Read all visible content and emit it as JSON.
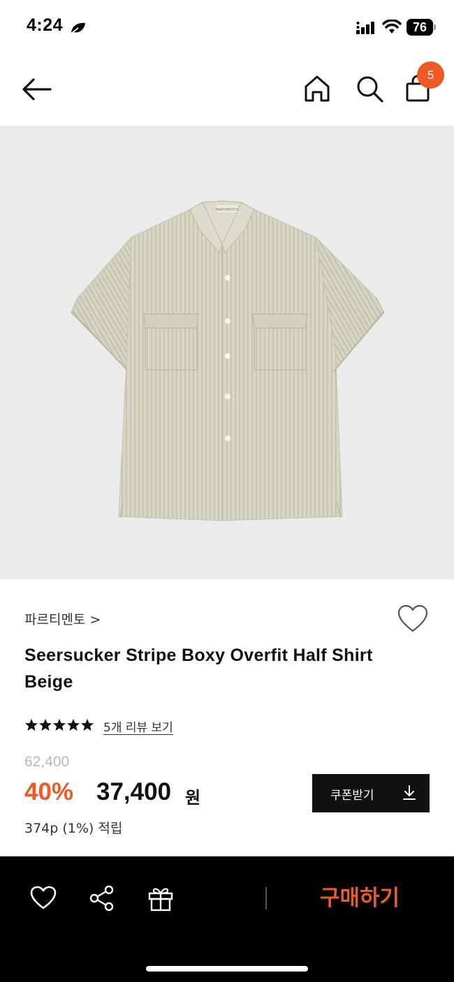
{
  "status_bar": {
    "time": "4:24",
    "battery": "76"
  },
  "nav": {
    "cart_count": "5"
  },
  "product": {
    "brand": "파르티멘토 >",
    "title": "Seersucker Stripe Boxy Overfit Half Shirt Beige",
    "rating_stars": 5,
    "review_link": "5개 리뷰 보기",
    "original_price": "62,400",
    "discount": "40%",
    "sale_price": "37,400",
    "currency": "원",
    "points": "374p (1%) 적립",
    "garment_label": "PARTIMENTO"
  },
  "coupon": {
    "label": "쿠폰받기",
    "icon": "download-icon"
  },
  "bottom_bar": {
    "buy_label": "구매하기",
    "icons": [
      "heart-icon",
      "share-icon",
      "gift-icon"
    ]
  },
  "colors": {
    "accent": "#ee5a24",
    "image_bg": "#ebebeb",
    "garment": "#d6d4c3"
  }
}
